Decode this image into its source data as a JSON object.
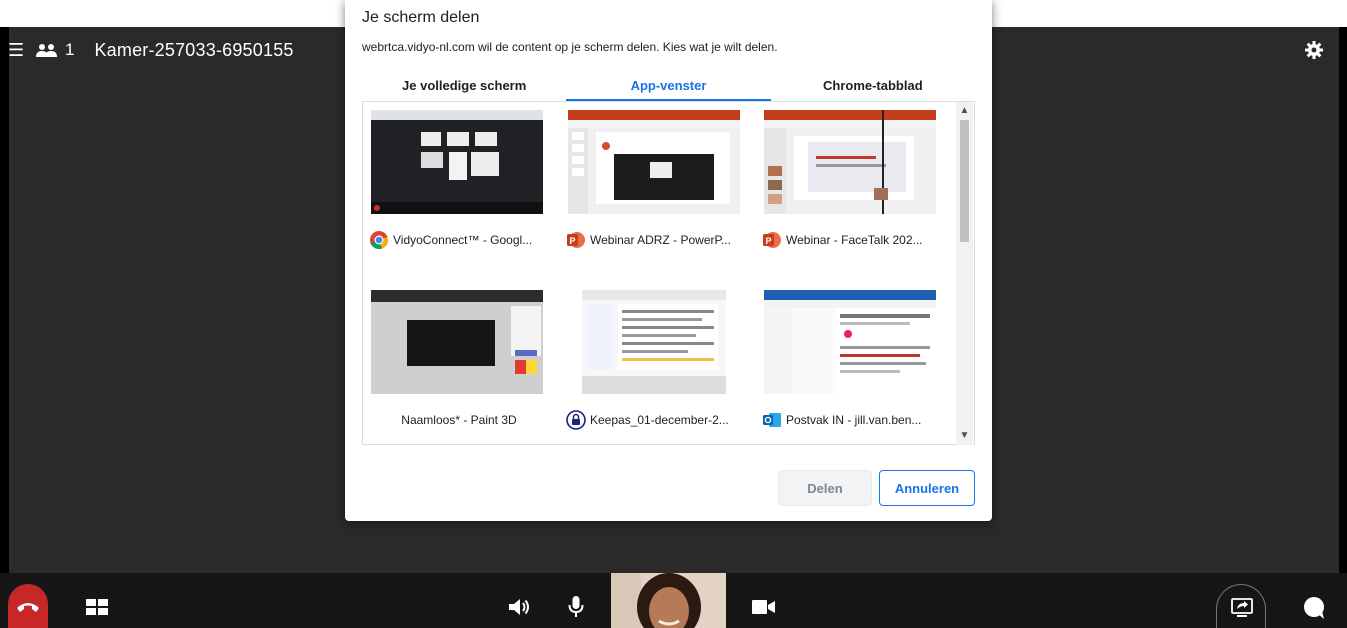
{
  "header": {
    "participant_count": "1",
    "room_name": "Kamer-257033-6950155"
  },
  "dialog": {
    "title": "Je scherm delen",
    "description": "webrtca.vidyo-nl.com wil de content op je scherm delen. Kies wat je wilt delen.",
    "tabs": [
      {
        "label": "Je volledige scherm",
        "active": false
      },
      {
        "label": "App-venster",
        "active": true
      },
      {
        "label": "Chrome-tabblad",
        "active": false
      }
    ],
    "windows": [
      {
        "label": "VidyoConnect™ - Googl...",
        "icon": "chrome-icon"
      },
      {
        "label": "Webinar ADRZ - PowerP...",
        "icon": "powerpoint-icon"
      },
      {
        "label": "Webinar  - FaceTalk 202...",
        "icon": "powerpoint-icon"
      },
      {
        "label": "Naamloos* - Paint 3D",
        "icon": ""
      },
      {
        "label": "Keepas_01-december-2...",
        "icon": "keepass-icon"
      },
      {
        "label": "Postvak IN - jill.van.ben...",
        "icon": "outlook-icon"
      }
    ],
    "share_label": "Delen",
    "cancel_label": "Annuleren"
  },
  "colors": {
    "accent": "#1a73e8",
    "hangup": "#c62828",
    "stage": "#2a2a2a",
    "bottombar": "#161616"
  }
}
